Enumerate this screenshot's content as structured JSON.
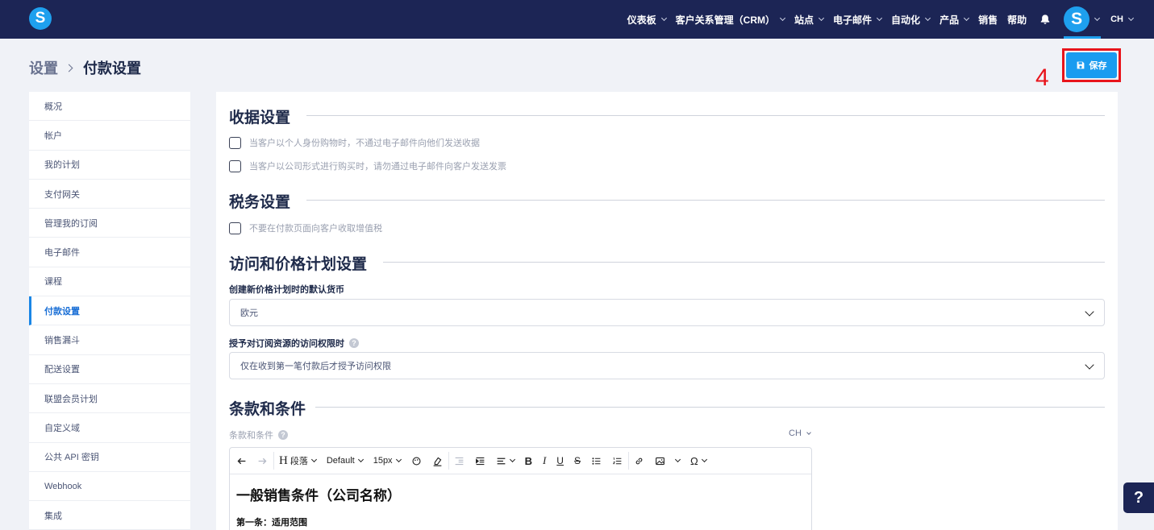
{
  "app": {
    "logo_letter": "S"
  },
  "nav": {
    "items": [
      "仪表板",
      "客户关系管理（CRM）",
      "站点",
      "电子邮件",
      "自动化",
      "产品",
      "销售",
      "帮助"
    ],
    "avatar_letter": "S",
    "language": "CH"
  },
  "breadcrumb": {
    "root": "设置",
    "current": "付款设置"
  },
  "toolbar": {
    "save_label": "保存"
  },
  "annotation": {
    "step": "4",
    "color": "#e8141b"
  },
  "sidebar": {
    "items": [
      {
        "label": "概况"
      },
      {
        "label": "帐户"
      },
      {
        "label": "我的计划"
      },
      {
        "label": "支付网关"
      },
      {
        "label": "管理我的订阅"
      },
      {
        "label": "电子邮件"
      },
      {
        "label": "课程"
      },
      {
        "label": "付款设置",
        "active": true
      },
      {
        "label": "销售漏斗"
      },
      {
        "label": "配送设置"
      },
      {
        "label": "联盟会员计划"
      },
      {
        "label": "自定义域"
      },
      {
        "label": "公共 API 密钥"
      },
      {
        "label": "Webhook"
      },
      {
        "label": "集成"
      }
    ]
  },
  "receipt": {
    "title": "收据设置",
    "options": [
      "当客户以个人身份购物时，不通过电子邮件向他们发送收据",
      "当客户以公司形式进行购买时，请勿通过电子邮件向客户发送发票"
    ]
  },
  "tax": {
    "title": "税务设置",
    "options": [
      "不要在付款页面向客户收取增值税"
    ]
  },
  "access": {
    "title": "访问和价格计划设置",
    "currency_label": "创建新价格计划时的默认货币",
    "currency_value": "欧元",
    "access_label": "授予对订阅资源的访问权限时",
    "access_help": "?",
    "access_value": "仅在收到第一笔付款后才授予访问权限"
  },
  "terms": {
    "title": "条款和条件",
    "field_label": "条款和条件",
    "field_help": "?",
    "language": "CH",
    "editor": {
      "paragraph_label": "段落",
      "font_label": "Default",
      "size_label": "15px",
      "heading": "一般销售条件（公司名称）",
      "subheading": "第一条：适用范围"
    }
  },
  "help_fab": "?",
  "colors": {
    "nav_bg": "#1c2555",
    "accent": "#1a9cf0",
    "active_link": "#1a6fd6"
  }
}
